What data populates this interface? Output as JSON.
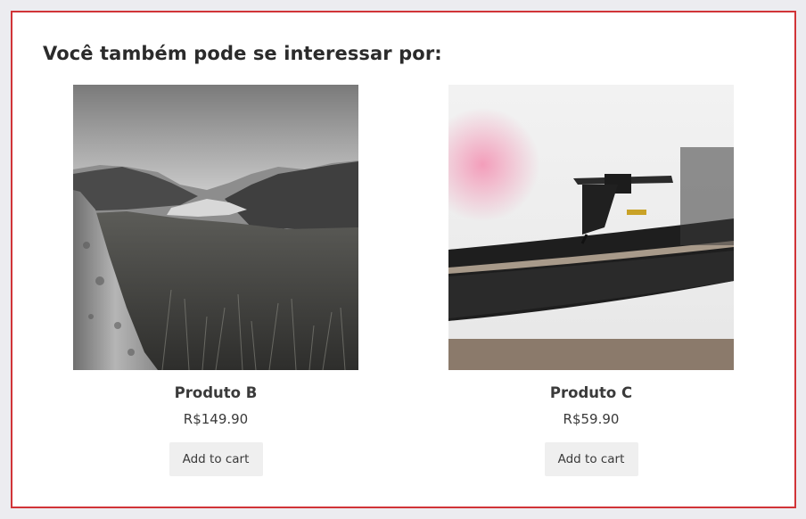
{
  "section": {
    "heading": "Você também pode se interessar por:"
  },
  "products": [
    {
      "title": "Produto B",
      "price": "R$149.90",
      "button_label": "Add to cart",
      "image_subject": "black-and-white mountain valley landscape"
    },
    {
      "title": "Produto C",
      "price": "R$59.90",
      "button_label": "Add to cart",
      "image_subject": "vinyl record turntable close-up"
    }
  ],
  "colors": {
    "panel_border": "#d13438",
    "page_background": "#ececf0",
    "button_background": "#efefef",
    "text": "#3a3a3a"
  }
}
